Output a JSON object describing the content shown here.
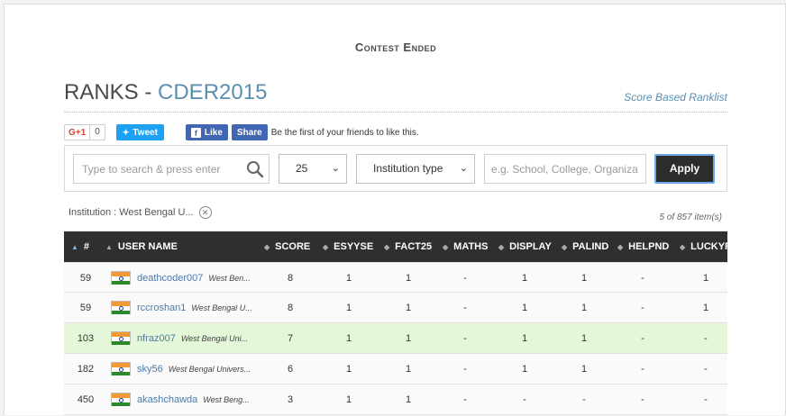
{
  "header": {
    "contest_status": "Contest Ended"
  },
  "title": {
    "prefix": "RANKS - ",
    "contest_code": "CDER2015",
    "ranklist_link": "Score Based Ranklist"
  },
  "social": {
    "gplus_label": "G+1",
    "gplus_count": "0",
    "tweet_label": "Tweet",
    "fb_like_label": "Like",
    "fb_share_label": "Share",
    "fb_text": "Be the first of your friends to like this."
  },
  "filters": {
    "search_placeholder": "Type to search & press enter",
    "page_size": "25",
    "institution_type": "Institution type",
    "institution_placeholder": "e.g. School, College, Organiza",
    "apply_label": "Apply",
    "active_filter": "Institution : West Bengal U...",
    "items_count": "5 of 857 item(s)"
  },
  "table": {
    "columns": [
      "#",
      "USER NAME",
      "SCORE",
      "ESYYSE",
      "FACT25",
      "MATHS",
      "DISPLAY",
      "PALIND",
      "HELPND",
      "LUCKYR"
    ],
    "rows": [
      {
        "rank": "59",
        "user": "deathcoder007",
        "inst": "West Ben...",
        "score": "8",
        "esyyse": "1",
        "fact25": "1",
        "maths": "-",
        "display": "1",
        "palind": "1",
        "helpnd": "-",
        "luckyr": "1",
        "highlight": false
      },
      {
        "rank": "59",
        "user": "rccroshan1",
        "inst": "West Bengal U...",
        "score": "8",
        "esyyse": "1",
        "fact25": "1",
        "maths": "-",
        "display": "1",
        "palind": "1",
        "helpnd": "-",
        "luckyr": "1",
        "highlight": false
      },
      {
        "rank": "103",
        "user": "nfraz007",
        "inst": "West Bengal Uni...",
        "score": "7",
        "esyyse": "1",
        "fact25": "1",
        "maths": "-",
        "display": "1",
        "palind": "1",
        "helpnd": "-",
        "luckyr": "-",
        "highlight": true
      },
      {
        "rank": "182",
        "user": "sky56",
        "inst": "West Bengal Univers...",
        "score": "6",
        "esyyse": "1",
        "fact25": "1",
        "maths": "-",
        "display": "1",
        "palind": "1",
        "helpnd": "-",
        "luckyr": "-",
        "highlight": false
      },
      {
        "rank": "450",
        "user": "akashchawda",
        "inst": "West Beng...",
        "score": "3",
        "esyyse": "1",
        "fact25": "1",
        "maths": "-",
        "display": "-",
        "palind": "-",
        "helpnd": "-",
        "luckyr": "-",
        "highlight": false
      }
    ]
  },
  "colors": {
    "link": "#5a8fb0",
    "header_bg": "#2f2f2f",
    "highlight_row": "#e4f7d9",
    "apply_bg": "#2c2c2c"
  }
}
